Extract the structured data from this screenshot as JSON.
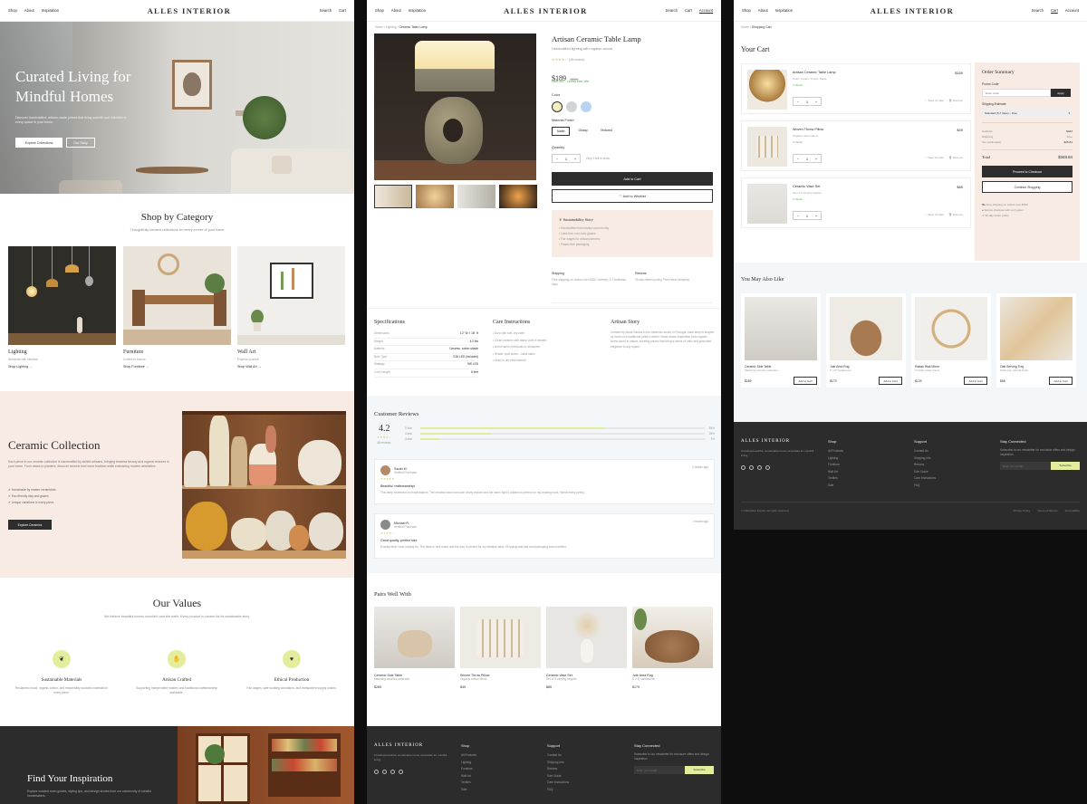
{
  "brand": "ALLES INTERIOR",
  "nav": {
    "shop": "Shop",
    "about": "About",
    "inspiration": "Inspiration",
    "search": "Search",
    "cart": "Cart",
    "account": "Account"
  },
  "home": {
    "hero_title_1": "Curated Living for",
    "hero_title_2": "Mindful Homes",
    "hero_sub": "Discover handcrafted, artisan-made pieces that bring warmth and intention to every space in your home.",
    "hero_btn_primary": "Explore Collections",
    "hero_btn_secondary": "Our Story",
    "categories_title": "Shop by Category",
    "categories_sub": "Thoughtfully curated collections for every corner of your home",
    "categories": [
      {
        "name": "Lighting",
        "desc": "Illuminate with intention",
        "link": "Shop Lighting"
      },
      {
        "name": "Furniture",
        "desc": "Crafted to endure",
        "link": "Shop Furniture"
      },
      {
        "name": "Wall Art",
        "desc": "Express yourself",
        "link": "Shop Wall Art"
      }
    ],
    "ceramic_title": "Ceramic Collection",
    "ceramic_desc": "Each piece in our ceramic collection is handcrafted by skilled artisans, bringing timeless beauty and organic textures to your home. From vases to planters, discover vessels that honor tradition while embracing modern aesthetics.",
    "ceramic_points": [
      "Handmade by master ceramicists",
      "Eco-friendly clay and glazes",
      "Unique variations in every piece"
    ],
    "ceramic_btn": "Explore Ceramics",
    "values_title": "Our Values",
    "values_sub": "We believe beautiful homes shouldn't cost the earth. Every product is chosen for its sustainable story.",
    "values": [
      {
        "name": "Sustainable Materials",
        "desc": "Reclaimed wood, organic cotton, and responsibly sourced materials in every piece."
      },
      {
        "name": "Artisan Crafted",
        "desc": "Supporting independent makers and traditional craftsmanship worldwide."
      },
      {
        "name": "Ethical Production",
        "desc": "Fair wages, safe working conditions, and transparent supply chains."
      }
    ],
    "inspiration_title": "Find Your Inspiration",
    "inspiration_sub": "Explore curated room guides, styling tips, and design stories from our community of mindful homemakers."
  },
  "product": {
    "breadcrumb_home": "Home",
    "breadcrumb_cat": "Lighting",
    "breadcrumb_item": "Ceramic Table Lamp",
    "name": "Artisan Ceramic Table Lamp",
    "subtitle": "Handcrafted lighting with organic curves",
    "reviews_count": "(48 reviews)",
    "price": "$189",
    "old_price": "$229",
    "save_text": "Save $40 – Limited time offer",
    "color_label": "Color",
    "finish_label": "Material Finish",
    "finishes": [
      "Matte",
      "Glossy",
      "Textured"
    ],
    "qty_label": "Quantity",
    "qty": "1",
    "stock": "Only 3 left in stock",
    "add_to_cart": "Add to Cart",
    "wishlist": "Add to Wishlist",
    "sustain_title": "Sustainability Story",
    "sustain_points": [
      "Handcrafted from locally sourced clay",
      "Lead-free, non-toxic glazes",
      "Fair wages for artisan partners",
      "Plastic-free packaging"
    ],
    "shipping_title": "Shipping",
    "shipping_text": "Free shipping on orders over $150. Delivery: 5-7 business days",
    "returns_title": "Returns",
    "returns_text": "30-day returns policy. Free return shipping",
    "spec_title": "Specifications",
    "specs": [
      {
        "k": "Dimensions",
        "v": "12\" W × 18\" H"
      },
      {
        "k": "Weight",
        "v": "4.2 lbs"
      },
      {
        "k": "Material",
        "v": "Ceramic, cotton shade"
      },
      {
        "k": "Bulb Type",
        "v": "E26 LED (included)"
      },
      {
        "k": "Wattage",
        "v": "9W LED"
      },
      {
        "k": "Cord Length",
        "v": "6 feet"
      }
    ],
    "care_title": "Care Instructions",
    "care": [
      "Dust with soft, dry cloth",
      "Clean ceramic with damp cloth if needed",
      "Avoid harsh chemicals or abrasives",
      "Shade: spot clean – hand-wash",
      "Keep in dry environment"
    ],
    "artisan_title": "Artisan Story",
    "artisan_text": "Created by Maria Santos in her ceramics studio in Portugal, each lamp is shaped by hand on a traditional potter's wheel. Maria draws inspiration from organic forms found in nature, creating pieces that bring a sense of calm and grounded elegance to any space.",
    "reviews_title": "Customer Reviews",
    "rating": "4.2",
    "rating_count": "48 reviews",
    "rating_bars": [
      {
        "label": "5 star",
        "fill": 0.65,
        "pct": "65%"
      },
      {
        "label": "4 star",
        "fill": 0.25,
        "pct": "25%"
      },
      {
        "label": "3 star",
        "fill": 0.07,
        "pct": "7%"
      }
    ],
    "reviews": [
      {
        "name": "Sarah M.",
        "verified": "Verified Purchase",
        "date": "2 weeks ago",
        "title": "Beautiful craftsmanship!",
        "text": "This lamp exceeded my expectations. The ceramic base has such lovely texture and the warm light it creates is perfect for my reading nook. Worth every penny."
      },
      {
        "name": "Michael R.",
        "verified": "Verified Purchase",
        "date": "1 month ago",
        "title": "Great quality, perfect size",
        "text": "Exactly what I was looking for. The base is well made and the size is perfect for my bedside table. Shipping was fast and packaging was excellent."
      }
    ],
    "pairs_title": "Pairs Well With",
    "pairs": [
      {
        "name": "Ceramic Side Table",
        "desc": "Matching ceramic collection",
        "price": "$289"
      },
      {
        "name": "Woven Throw Pillow",
        "desc": "Organic cotton blend",
        "price": "$49"
      },
      {
        "name": "Ceramic Vase Set",
        "desc": "Set of 3 varying heights",
        "price": "$85"
      },
      {
        "name": "Jute Area Rug",
        "desc": "5' x 8' handwoven",
        "price": "$179"
      }
    ]
  },
  "cart": {
    "breadcrumb_home": "Home",
    "breadcrumb_item": "Shopping Cart",
    "title": "Your Cart",
    "items": [
      {
        "name": "Artisan Ceramic Table Lamp",
        "desc": "Color: Cream / Finish: Matte",
        "stock": "In Stock",
        "price": "$189",
        "qty": "1"
      },
      {
        "name": "Woven Throw Pillow",
        "desc": "Organic cotton blend",
        "stock": "In Stock",
        "price": "$49",
        "qty": "1"
      },
      {
        "name": "Ceramic Vase Set",
        "desc": "Set of 3 varying heights",
        "stock": "In Stock",
        "price": "$85",
        "qty": "1"
      }
    ],
    "save_for_later": "Save for later",
    "remove": "Remove",
    "summary_title": "Order Summary",
    "promo_label": "Promo Code",
    "promo_placeholder": "Enter code",
    "apply": "Apply",
    "ship_label": "Shipping Estimate",
    "ship_option": "Standard (5-7 days) – Free",
    "subtotal_label": "Subtotal",
    "subtotal": "$323",
    "shipping_label": "Shipping",
    "shipping": "Free",
    "tax_label": "Tax (estimated)",
    "tax": "$25.84",
    "total_label": "Total",
    "total": "$348.84",
    "checkout": "Proceed to Checkout",
    "continue": "Continue Shopping",
    "trust": [
      "Free shipping on orders over $150",
      "Secure checkout with encryption",
      "30-day return policy"
    ],
    "also_title": "You May Also Like",
    "also": [
      {
        "name": "Ceramic Side Table",
        "desc": "Matching ceramic collection",
        "price": "$289"
      },
      {
        "name": "Jute Area Rug",
        "desc": "5' x 8' handwoven",
        "price": "$179"
      },
      {
        "name": "Rattan Wall Mirror",
        "desc": "Circular rattan frame",
        "price": "$129"
      },
      {
        "name": "Oak Serving Tray",
        "desc": "Solid oak, natural finish",
        "price": "$68"
      }
    ],
    "add_to_cart": "Add to Cart"
  },
  "footer": {
    "about": "Curating beautiful, sustainable home essentials for mindful living.",
    "shop_title": "Shop",
    "shop_links": [
      "All Products",
      "Lighting",
      "Furniture",
      "Wall Art",
      "Textiles",
      "Sale"
    ],
    "support_title": "Support",
    "support_links": [
      "Contact Us",
      "Shipping Info",
      "Returns",
      "Size Guide",
      "Care Instructions",
      "FAQ"
    ],
    "connect_title": "Stay Connected",
    "connect_text": "Subscribe to our newsletter for exclusive offers and design inspiration.",
    "email_placeholder": "Enter your email",
    "subscribe": "Subscribe",
    "copyright": "© 2024 Alles Interior. All rights reserved.",
    "legal": [
      "Privacy Policy",
      "Terms of Service",
      "Accessibility"
    ]
  },
  "colors": {
    "accent": "#e4ed9c",
    "dark": "#2c2c2c",
    "blush": "#f8ebe4",
    "mist": "#f4f7f9"
  }
}
